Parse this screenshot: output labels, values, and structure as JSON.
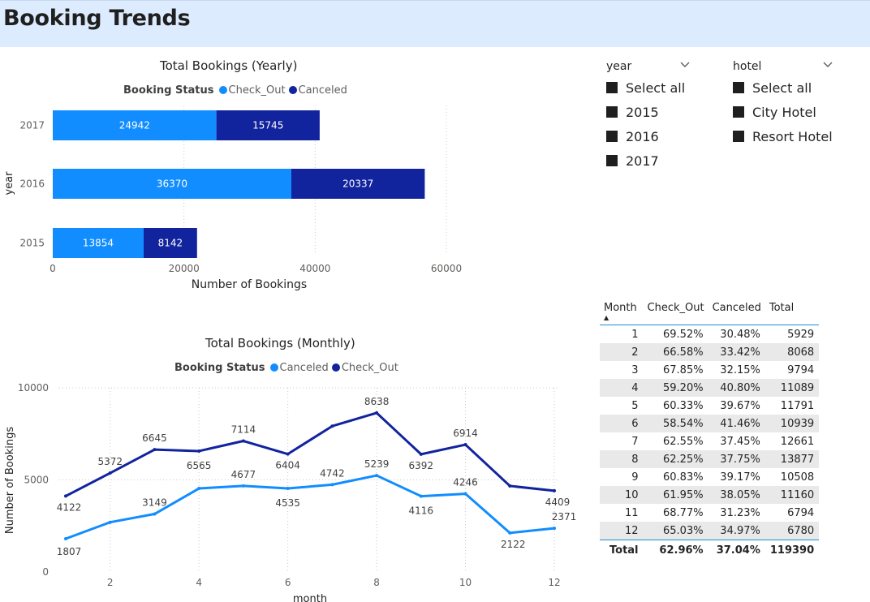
{
  "header": {
    "title": "Booking Trends"
  },
  "yearly_chart": {
    "title": "Total Bookings (Yearly)",
    "legend_title": "Booking Status",
    "legend": [
      "Check_Out",
      "Canceled"
    ],
    "ylabel": "year",
    "xlabel": "Number of Bookings",
    "xticks": [
      "0",
      "20000",
      "40000",
      "60000"
    ]
  },
  "monthly_chart": {
    "title": "Total Bookings (Monthly)",
    "legend_title": "Booking Status",
    "legend": [
      "Canceled",
      "Check_Out"
    ],
    "ylabel": "Number of Bookings",
    "xlabel": "month",
    "yticks": [
      "10000",
      "5000",
      "0"
    ],
    "xticks": [
      "2",
      "4",
      "6",
      "8",
      "10",
      "12"
    ]
  },
  "colors": {
    "check_out": "#118dff",
    "canceled": "#12239e",
    "line_canceled": "#118dff",
    "line_check_out": "#12239e"
  },
  "chart_data": [
    {
      "type": "bar",
      "orientation": "horizontal",
      "stacked": true,
      "title": "Total Bookings (Yearly)",
      "categories": [
        "2017",
        "2016",
        "2015"
      ],
      "series": [
        {
          "name": "Check_Out",
          "values": [
            24942,
            36370,
            13854
          ]
        },
        {
          "name": "Canceled",
          "values": [
            15745,
            20337,
            8142
          ]
        }
      ],
      "xlabel": "Number of Bookings",
      "ylabel": "year",
      "xlim": [
        0,
        60000
      ]
    },
    {
      "type": "line",
      "title": "Total Bookings (Monthly)",
      "x": [
        1,
        2,
        3,
        4,
        5,
        6,
        7,
        8,
        9,
        10,
        11,
        12
      ],
      "series": [
        {
          "name": "Canceled",
          "values": [
            1807,
            2700,
            3149,
            4535,
            4677,
            4535,
            4742,
            5239,
            4116,
            4246,
            2122,
            2371
          ],
          "labels": [
            "1807",
            null,
            "3149",
            null,
            "4677",
            "4535",
            "4742",
            "5239",
            "4116",
            "4246",
            "2122",
            "2371"
          ]
        },
        {
          "name": "Check_Out",
          "values": [
            4122,
            5372,
            6645,
            6565,
            7114,
            6404,
            7919,
            8638,
            6392,
            6914,
            4672,
            4409
          ],
          "labels": [
            "4122",
            "5372",
            "6645",
            "6565",
            "7114",
            "6404",
            null,
            "8638",
            "6392",
            "6914",
            null,
            "4409"
          ]
        }
      ],
      "xlabel": "month",
      "ylabel": "Number of Bookings",
      "ylim": [
        0,
        10000
      ]
    }
  ],
  "slicers": {
    "year": {
      "title": "year",
      "items": [
        "Select all",
        "2015",
        "2016",
        "2017"
      ]
    },
    "hotel": {
      "title": "hotel",
      "items": [
        "Select all",
        "City Hotel",
        "Resort Hotel"
      ]
    }
  },
  "table": {
    "headers": [
      "Month",
      "Check_Out",
      "Canceled",
      "Total"
    ],
    "rows": [
      [
        "1",
        "69.52%",
        "30.48%",
        "5929"
      ],
      [
        "2",
        "66.58%",
        "33.42%",
        "8068"
      ],
      [
        "3",
        "67.85%",
        "32.15%",
        "9794"
      ],
      [
        "4",
        "59.20%",
        "40.80%",
        "11089"
      ],
      [
        "5",
        "60.33%",
        "39.67%",
        "11791"
      ],
      [
        "6",
        "58.54%",
        "41.46%",
        "10939"
      ],
      [
        "7",
        "62.55%",
        "37.45%",
        "12661"
      ],
      [
        "8",
        "62.25%",
        "37.75%",
        "13877"
      ],
      [
        "9",
        "60.83%",
        "39.17%",
        "10508"
      ],
      [
        "10",
        "61.95%",
        "38.05%",
        "11160"
      ],
      [
        "11",
        "68.77%",
        "31.23%",
        "6794"
      ],
      [
        "12",
        "65.03%",
        "34.97%",
        "6780"
      ]
    ],
    "total": [
      "Total",
      "62.96%",
      "37.04%",
      "119390"
    ]
  }
}
